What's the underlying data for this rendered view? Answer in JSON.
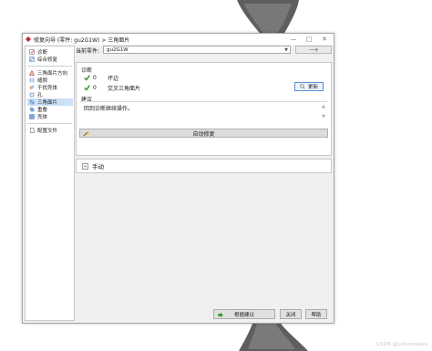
{
  "window": {
    "title": "修复向导 (零件: gu2G1W) > 三角面片",
    "controls": {
      "minimize": "—",
      "maximize": "□",
      "close": "✕"
    }
  },
  "sidebar": {
    "groups": [
      {
        "items": [
          {
            "label": "诊断",
            "icon": "stethoscope-icon"
          },
          {
            "label": "综合修复",
            "icon": "repair-icon"
          }
        ]
      },
      {
        "items": [
          {
            "label": "三角面片方向",
            "icon": "orientation-icon"
          },
          {
            "label": "缝隙",
            "icon": "gap-icon"
          },
          {
            "label": "干扰壳体",
            "icon": "shell-icon"
          },
          {
            "label": "孔",
            "icon": "hole-icon"
          },
          {
            "label": "三角面片",
            "icon": "triangle-icon",
            "selected": true
          },
          {
            "label": "重叠",
            "icon": "overlap-icon"
          },
          {
            "label": "壳体",
            "icon": "shell-icon"
          }
        ]
      },
      {
        "items": [
          {
            "label": "配置文件",
            "icon": "document-icon"
          }
        ]
      }
    ]
  },
  "part": {
    "label": "当前零件:",
    "value": "gu2G1W"
  },
  "diagnose": {
    "title": "诊断",
    "rows": [
      {
        "count": "0",
        "label": "坏边"
      },
      {
        "count": "0",
        "label": "交叉三角面片"
      }
    ],
    "update_label": "更新"
  },
  "suggestion": {
    "title": "建议",
    "text": "回到诊断继续操作。"
  },
  "autofix_label": "自动修复",
  "manual_label": "手动",
  "footer": {
    "follow_label": "根据建议",
    "close_label": "关闭",
    "help_label": "帮助"
  },
  "watermark": "CSDN @luoluonaiwa",
  "colors": {
    "check": "#2e8b2e",
    "selected": "#cce0f6",
    "accent": "#5a8fd6"
  }
}
